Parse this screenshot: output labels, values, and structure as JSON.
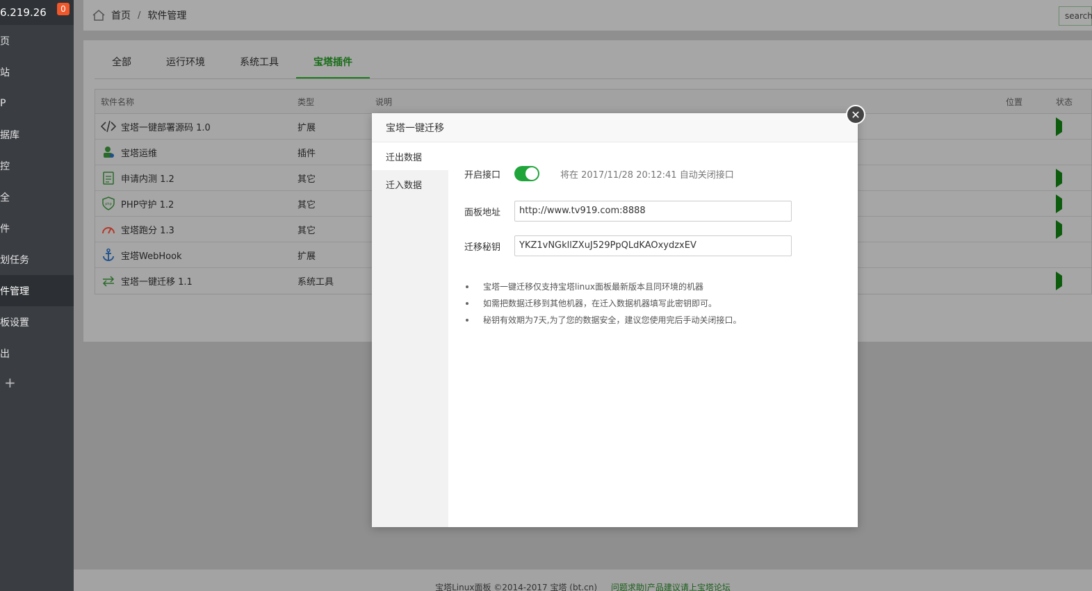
{
  "sidebar": {
    "ip": "6.219.26",
    "badge": "0",
    "items": [
      {
        "label": "页"
      },
      {
        "label": "站"
      },
      {
        "label": "P"
      },
      {
        "label": "据库"
      },
      {
        "label": "控"
      },
      {
        "label": "全"
      },
      {
        "label": "件"
      },
      {
        "label": "划任务"
      },
      {
        "label": "件管理"
      },
      {
        "label": "板设置"
      },
      {
        "label": "出"
      }
    ],
    "add": "+"
  },
  "topbar": {
    "home": "首页",
    "separator": "/",
    "current": "软件管理",
    "search_placeholder": "search"
  },
  "tabs": [
    {
      "label": "全部"
    },
    {
      "label": "运行环境"
    },
    {
      "label": "系统工具"
    },
    {
      "label": "宝塔插件"
    }
  ],
  "table": {
    "headers": {
      "name": "软件名称",
      "type": "类型",
      "desc": "说明",
      "pos": "位置",
      "status": "状态"
    },
    "rows": [
      {
        "name": "宝塔一键部署源码 1.0",
        "type": "扩展",
        "icon": "code-icon"
      },
      {
        "name": "宝塔运维",
        "type": "插件",
        "icon": "ops-icon"
      },
      {
        "name": "申请内测 1.2",
        "type": "其它",
        "icon": "clipboard-icon"
      },
      {
        "name": "PHP守护 1.2",
        "type": "其它",
        "icon": "php-shield-icon"
      },
      {
        "name": "宝塔跑分 1.3",
        "type": "其它",
        "icon": "gauge-icon"
      },
      {
        "name": "宝塔WebHook",
        "type": "扩展",
        "icon": "anchor-icon"
      },
      {
        "name": "宝塔一键迁移 1.1",
        "type": "系统工具",
        "icon": "transfer-icon"
      }
    ]
  },
  "footer": {
    "copyright": "宝塔Linux面板 ©2014-2017 宝塔 (bt.cn)",
    "link": "问题求助|产品建议请上宝塔论坛"
  },
  "modal": {
    "title": "宝塔一键迁移",
    "side_items": [
      {
        "label": "迁出数据"
      },
      {
        "label": "迁入数据"
      }
    ],
    "enable_label": "开启接口",
    "enable_note": "将在 2017/11/28 20:12:41 自动关闭接口",
    "panel_label": "面板地址",
    "panel_value": "http://www.tv919.com:8888",
    "key_label": "迁移秘钥",
    "key_value": "YKZ1vNGkllZXuJ529PpQLdKAOxydzxEV",
    "tips": [
      "宝塔一键迁移仅支持宝塔linux面板最新版本且同环境的机器",
      "如需把数据迁移到其他机器，在迁入数据机器填写此密钥即可。",
      "秘钥有效期为7天,为了您的数据安全，建议您使用完后手动关闭接口。"
    ],
    "close": "✕"
  }
}
